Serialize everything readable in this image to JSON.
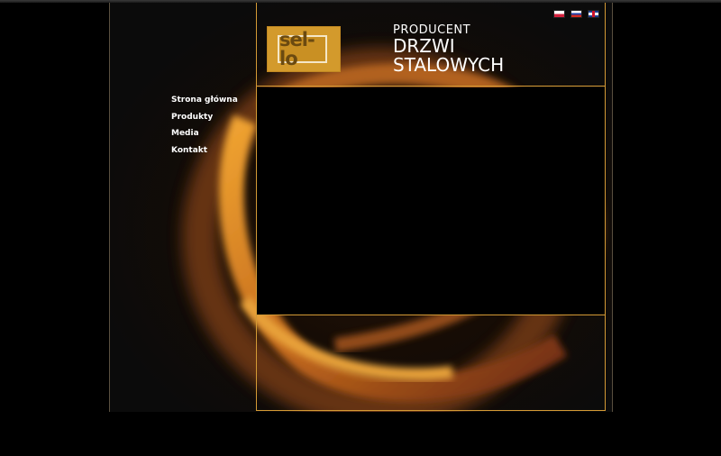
{
  "languages": [
    {
      "name": "polish-flag-icon"
    },
    {
      "name": "russian-flag-icon"
    },
    {
      "name": "english-flag-icon"
    }
  ],
  "logo": {
    "text": "sel-lo"
  },
  "headline": {
    "line1": "PRODUCENT",
    "line2": "DRZWI",
    "line3": "STALOWYCH"
  },
  "nav": {
    "items": [
      {
        "label": "Strona główna"
      },
      {
        "label": "Produkty"
      },
      {
        "label": "Media"
      },
      {
        "label": "Kontakt"
      }
    ]
  },
  "colors": {
    "accent": "#d49a35",
    "logo_bg": "#d39a2c",
    "background": "#000000"
  }
}
